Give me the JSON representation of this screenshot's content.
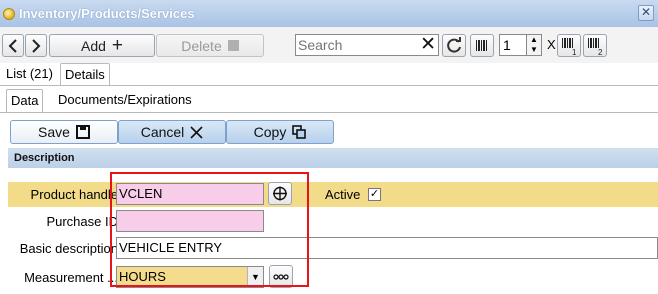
{
  "window": {
    "title": "Inventory/Products/Services"
  },
  "toolbar": {
    "add_label": "Add",
    "delete_label": "Delete",
    "search_placeholder": "Search",
    "quantity": "1",
    "multiply": "X"
  },
  "tabs_top": [
    {
      "label": "List (21)"
    },
    {
      "label": "Details"
    }
  ],
  "tabs_sub": [
    {
      "label": "Data"
    },
    {
      "label": "Documents/Expirations"
    }
  ],
  "actions": {
    "save_label": "Save",
    "cancel_label": "Cancel",
    "copy_label": "Copy"
  },
  "section": {
    "title": "Description"
  },
  "form": {
    "product_handle": {
      "label": "Product handle",
      "value": "VCLEN"
    },
    "active": {
      "label": "Active",
      "checked": true
    },
    "purchase_id": {
      "label": "Purchase ID",
      "value": ""
    },
    "basic_description": {
      "label": "Basic description",
      "value": "VEHICLE ENTRY"
    },
    "measurement": {
      "label": "Measurement ...",
      "value": "HOURS"
    }
  },
  "colors": {
    "titlebar": "#a9c3e6",
    "required_field": "#f7cde9",
    "row_highlight": "#f2dc8a",
    "annotation_box": "#e8141c"
  }
}
